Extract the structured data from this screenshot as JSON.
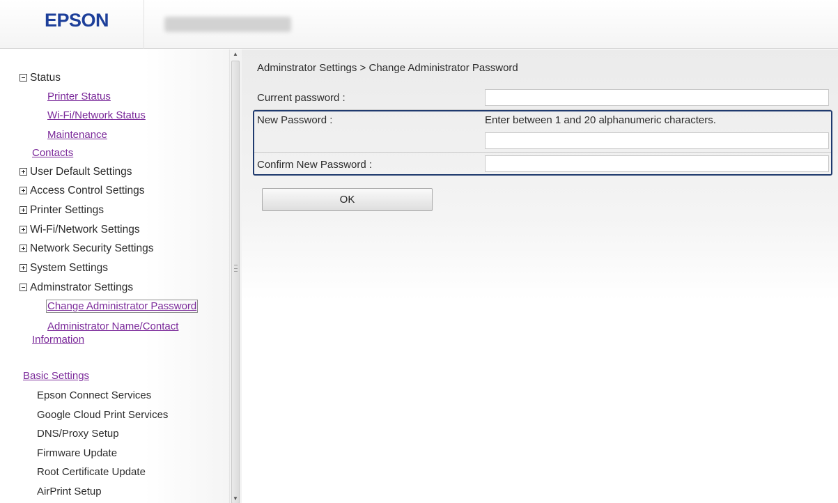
{
  "header": {
    "logo": "EPSON",
    "model_name": "(obscured)"
  },
  "sidebar": {
    "status": {
      "label": "Status",
      "links": [
        "Printer Status",
        "Wi-Fi/Network Status",
        "Maintenance"
      ]
    },
    "contacts": "Contacts",
    "collapsed_sections": [
      "User Default Settings",
      "Access Control Settings",
      "Printer Settings",
      "Wi-Fi/Network Settings",
      "Network Security Settings",
      "System Settings"
    ],
    "admin": {
      "label": "Adminstrator Settings",
      "active_link": "Change Administrator Password",
      "link2_line1": "Administrator Name/Contact",
      "link2_line2": "Information"
    },
    "basic_settings": {
      "label": "Basic Settings",
      "items": [
        "Epson Connect Services",
        "Google Cloud Print Services",
        "DNS/Proxy Setup",
        "Firmware Update",
        "Root Certificate Update",
        "AirPrint Setup"
      ]
    }
  },
  "main": {
    "breadcrumb": "Adminstrator Settings > Change Administrator Password",
    "current_password": {
      "label": "Current password :",
      "value": ""
    },
    "new_password": {
      "label": "New Password :",
      "hint": "Enter between 1 and 20 alphanumeric characters.",
      "value": ""
    },
    "confirm_password": {
      "label": "Confirm New Password :",
      "value": ""
    },
    "ok_label": "OK"
  },
  "colors": {
    "logo": "#1d3f9a",
    "link": "#7b2a9a",
    "highlight_border": "#1f3a6e"
  }
}
